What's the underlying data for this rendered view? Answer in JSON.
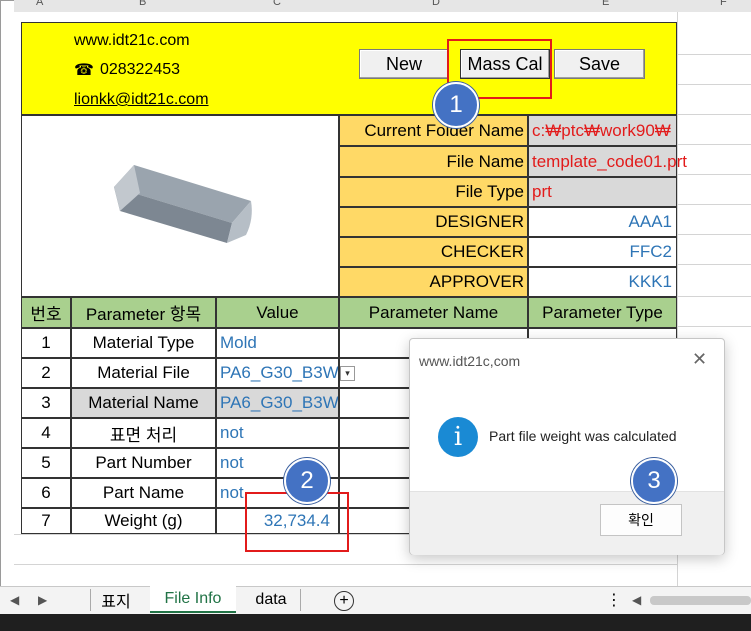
{
  "header": {
    "website": "www.idt21c.com",
    "phone_icon": "☎",
    "phone": "028322453",
    "email": "lionkk@idt21c.com"
  },
  "toolbar": {
    "new_label": "New",
    "masscal_label": "Mass Cal",
    "save_label": "Save"
  },
  "info": {
    "rows": [
      {
        "label": "Current Folder Name",
        "value": "c:₩ptc₩work90₩"
      },
      {
        "label": "File Name",
        "value": "template_code01.prt"
      },
      {
        "label": "File Type",
        "value": "prt"
      },
      {
        "label": "DESIGNER",
        "value": "AAA1"
      },
      {
        "label": "CHECKER",
        "value": "FFC2"
      },
      {
        "label": "APPROVER",
        "value": "KKK1"
      }
    ]
  },
  "table": {
    "headers": [
      "번호",
      "Parameter 항목",
      "Value",
      "Parameter Name",
      "Parameter Type"
    ],
    "rows": [
      {
        "no": "1",
        "item": "Material Type",
        "value": "Mold"
      },
      {
        "no": "2",
        "item": "Material File",
        "value": "PA6_G30_B3W"
      },
      {
        "no": "3",
        "item": "Material Name",
        "value": "PA6_G30_B3W"
      },
      {
        "no": "4",
        "item": "표면 처리",
        "value": "not"
      },
      {
        "no": "5",
        "item": "Part Number",
        "value": "not"
      },
      {
        "no": "6",
        "item": "Part Name",
        "value": "not"
      },
      {
        "no": "7",
        "item": "Weight (g)",
        "value": "32,734.4"
      }
    ]
  },
  "dialog": {
    "title": "www.idt21c,com",
    "message": "Part file weight was calculated",
    "ok_label": "확인",
    "info_icon": "i"
  },
  "markers": {
    "m1": "1",
    "m2": "2",
    "m3": "3"
  },
  "sheet_tabs": {
    "tab1": "표지",
    "tab2": "File Info",
    "tab3": "data"
  },
  "column_headers": [
    "A",
    "B",
    "C",
    "D",
    "E",
    "F"
  ],
  "colors": {
    "yellow": "#ffff00",
    "orange": "#ffd966",
    "green": "#a9d08e",
    "blue_value": "#2e75b6",
    "red_value": "#e21b1b",
    "marker": "#4472c4"
  }
}
